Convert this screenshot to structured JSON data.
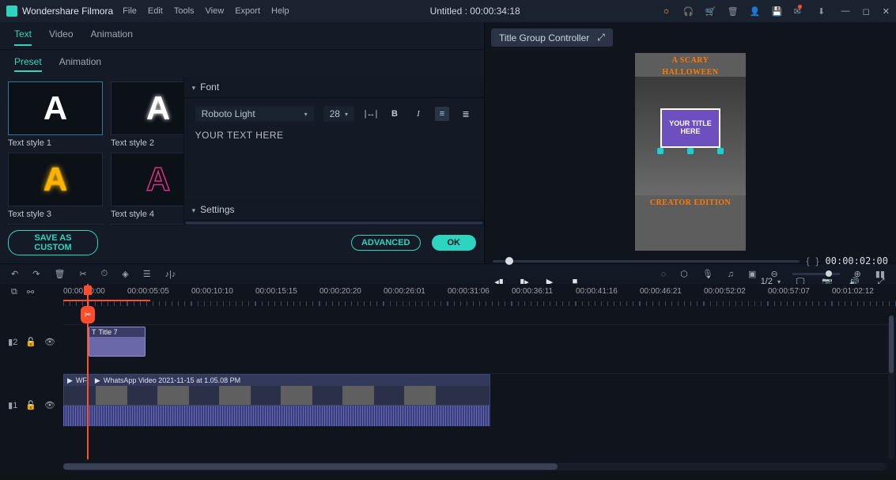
{
  "app_name": "Wondershare Filmora",
  "menu": {
    "file": "File",
    "edit": "Edit",
    "tools": "Tools",
    "view": "View",
    "export": "Export",
    "help": "Help"
  },
  "project_title": "Untitled : 00:00:34:18",
  "tabs": {
    "text": "Text",
    "video": "Video",
    "animation": "Animation"
  },
  "subtabs": {
    "preset": "Preset",
    "animation": "Animation"
  },
  "styles": {
    "s1": "Text style 1",
    "s2": "Text style 2",
    "s3": "Text style 3",
    "s4": "Text style 4"
  },
  "font_panel": {
    "font_header": "Font",
    "font_name": "Roboto Light",
    "font_size": "28",
    "placeholder": "YOUR TEXT HERE",
    "settings_header": "Settings"
  },
  "footer_buttons": {
    "save_custom": "SAVE AS CUSTOM",
    "advanced": "ADVANCED",
    "ok": "OK"
  },
  "preview": {
    "title_group": "Title Group Controller",
    "top_text_1": "A SCARY",
    "top_text_2": "HALLOWEEN",
    "title_box": "YOUR TITLE HERE",
    "bottom_text": "CREATOR EDITION",
    "bracket_left": "{",
    "bracket_right": "}",
    "current_time": "00:00:02:00",
    "zoom": "1/2"
  },
  "ruler": [
    "00:00:00:00",
    "00:00:05:05",
    "00:00:10:10",
    "00:00:15:15",
    "00:00:20:20",
    "00:00:26:01",
    "00:00:31:06",
    "00:00:36:11",
    "00:00:41:16",
    "00:00:46:21",
    "00:00:52:02",
    "00:00:57:07",
    "00:01:02:12"
  ],
  "timeline": {
    "title_clip": "Title 7",
    "video_clip": "WhatsApp Video 2021-11-15 at 1.05.08 PM",
    "video_stub": "WF"
  }
}
